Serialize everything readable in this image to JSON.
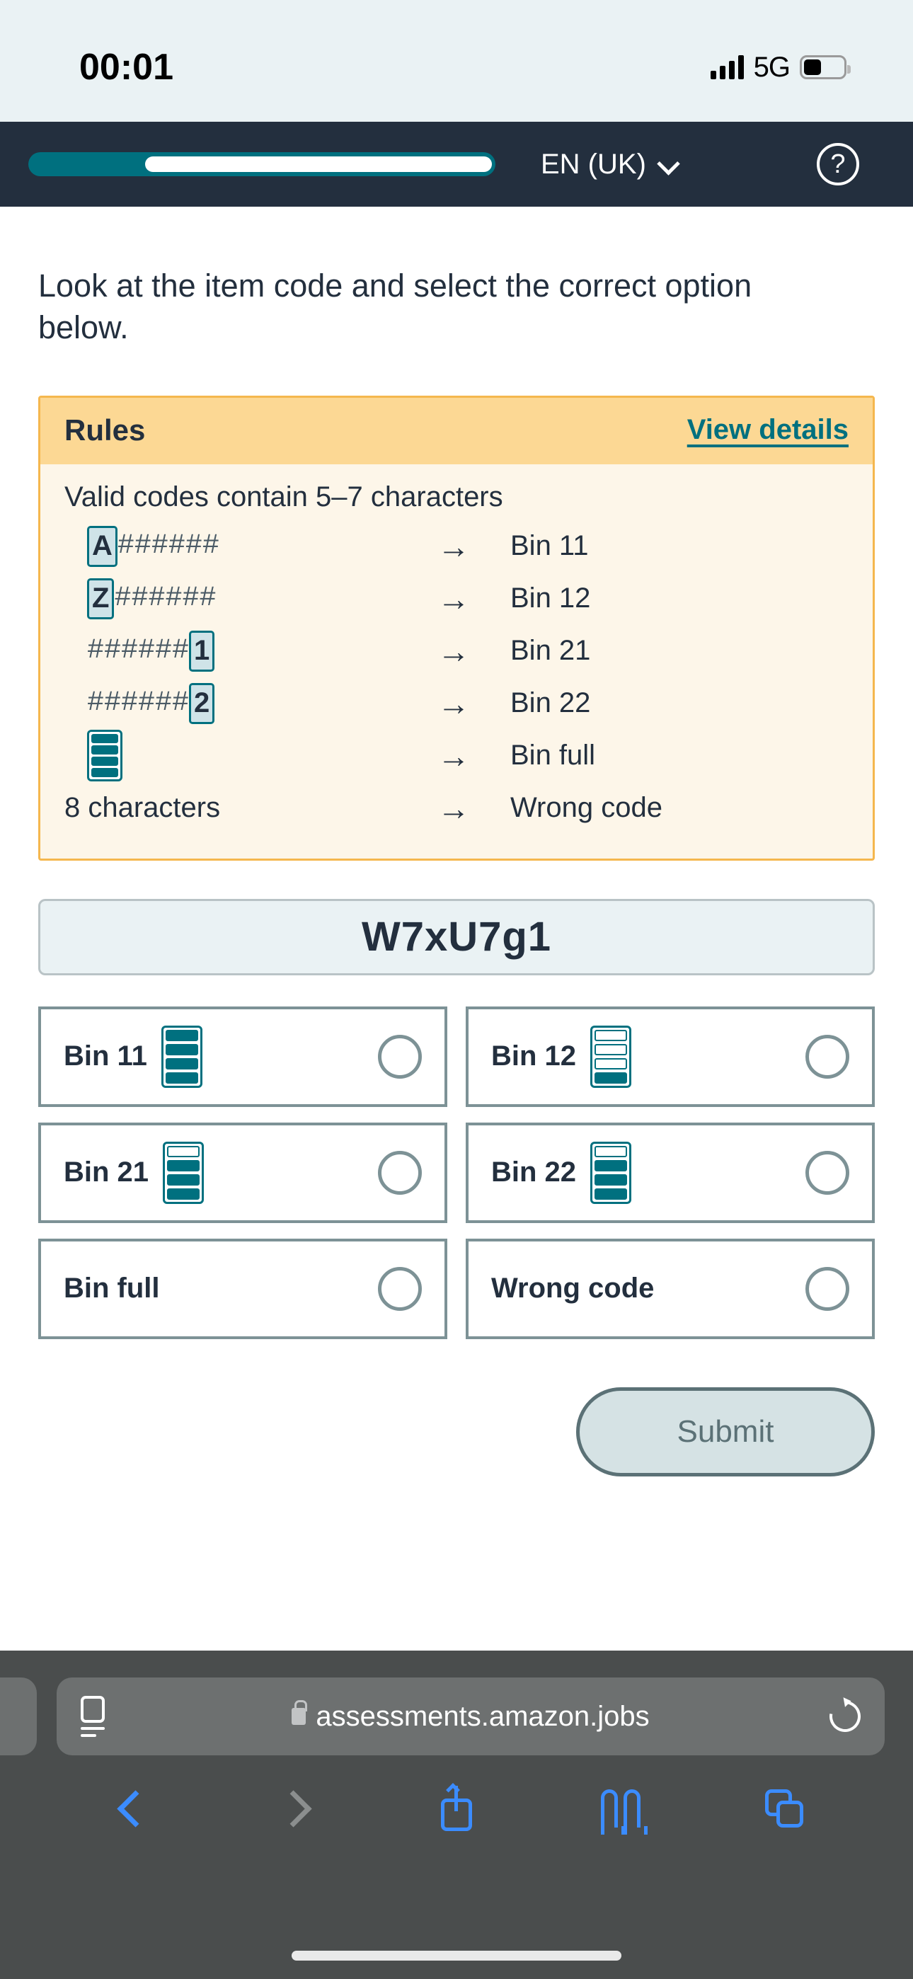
{
  "status_bar": {
    "time": "00:01",
    "network": "5G",
    "signal_icon": "signal-bars-icon",
    "battery_icon": "battery-icon"
  },
  "app_bar": {
    "progress_percent": 25,
    "language": "EN (UK)",
    "chevron_icon": "chevron-down-icon",
    "help_label": "?",
    "help_icon": "help-circle-icon"
  },
  "main": {
    "prompt": "Look at the item code and select the correct option below.",
    "rules": {
      "title": "Rules",
      "view_details": "View details",
      "intro": "Valid codes contain 5–7 characters",
      "rows": [
        {
          "prefix_chip": "A",
          "hashes": "######",
          "suffix_chip": "",
          "icon": "",
          "text": "",
          "arrow": "→",
          "result": "Bin 11"
        },
        {
          "prefix_chip": "Z",
          "hashes": "######",
          "suffix_chip": "",
          "icon": "",
          "text": "",
          "arrow": "→",
          "result": "Bin 12"
        },
        {
          "prefix_chip": "",
          "hashes": "######",
          "suffix_chip": "1",
          "icon": "",
          "text": "",
          "arrow": "→",
          "result": "Bin 21"
        },
        {
          "prefix_chip": "",
          "hashes": "######",
          "suffix_chip": "2",
          "icon": "",
          "text": "",
          "arrow": "→",
          "result": "Bin 22"
        },
        {
          "prefix_chip": "",
          "hashes": "",
          "suffix_chip": "",
          "icon": "bin-full-icon",
          "text": "",
          "arrow": "→",
          "result": "Bin full"
        },
        {
          "prefix_chip": "",
          "hashes": "",
          "suffix_chip": "",
          "icon": "",
          "text": "8 characters",
          "arrow": "→",
          "result": "Wrong code"
        }
      ]
    },
    "item_code": "W7xU7g1",
    "options": [
      {
        "label": "Bin 11",
        "icon": "bin-level-icon",
        "filled": [
          true,
          true,
          true,
          true
        ],
        "selected": false
      },
      {
        "label": "Bin 12",
        "icon": "bin-level-icon",
        "filled": [
          false,
          false,
          false,
          true
        ],
        "selected": false
      },
      {
        "label": "Bin 21",
        "icon": "bin-level-icon",
        "filled": [
          false,
          true,
          true,
          true
        ],
        "selected": false
      },
      {
        "label": "Bin 22",
        "icon": "bin-level-icon",
        "filled": [
          false,
          true,
          true,
          true
        ],
        "selected": false
      },
      {
        "label": "Bin full",
        "icon": "",
        "filled": [],
        "selected": false
      },
      {
        "label": "Wrong code",
        "icon": "",
        "filled": [],
        "selected": false
      }
    ],
    "submit_label": "Submit"
  },
  "browser": {
    "url": "assessments.amazon.jobs",
    "lock_icon": "lock-icon",
    "reader_icon": "page-settings-icon",
    "reload_icon": "reload-icon",
    "back_icon": "chevron-left-icon",
    "forward_icon": "chevron-right-icon",
    "share_icon": "share-icon",
    "bookmarks_icon": "book-icon",
    "tabs_icon": "tabs-icon"
  },
  "colors": {
    "brand_dark": "#232f3e",
    "teal": "#00707f",
    "amber_header": "#fcd894",
    "amber_body": "#fdf6e9",
    "amber_border": "#f5b74e",
    "option_border": "#7d9296",
    "link_blue": "#3b8cff"
  }
}
